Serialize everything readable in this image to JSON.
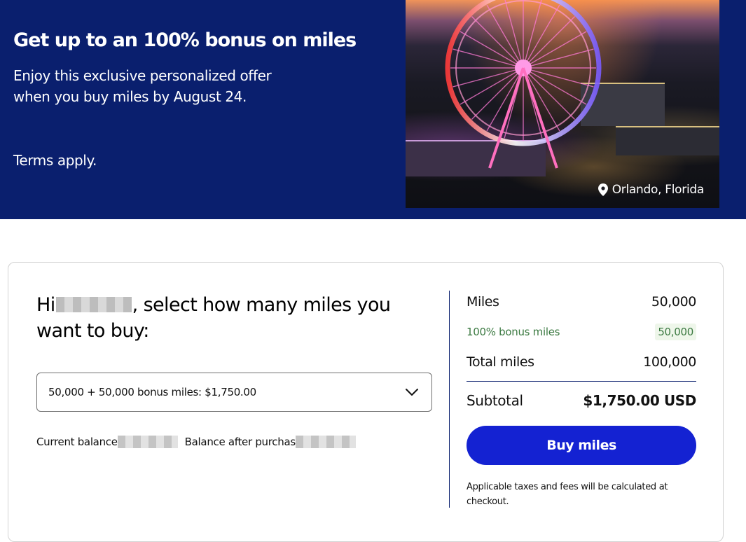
{
  "hero": {
    "title": "Get up to an 100% bonus on miles",
    "text": "Enjoy this exclusive personalized offer when you buy miles by August 24.",
    "terms": "Terms apply.",
    "photo_location": "Orlando, Florida",
    "location_icon": "map-pin-icon"
  },
  "purchase": {
    "greeting_start": "Hi",
    "greeting_end": ", select how many miles you want to buy:",
    "selected_option": "50,000 + 50,000 bonus miles: $1,750.00",
    "dropdown_icon": "chevron-down-icon",
    "current_balance_label": "Current balance",
    "balance_after_label": "Balance after purchas"
  },
  "summary": {
    "miles_label": "Miles",
    "miles_value": "50,000",
    "bonus_label": "100% bonus miles",
    "bonus_value": "50,000",
    "total_label": "Total miles",
    "total_value": "100,000",
    "subtotal_label": "Subtotal",
    "subtotal_value": "$1,750.00 USD",
    "buy_button": "Buy miles",
    "fine_print": "Applicable taxes and fees will be calculated at checkout."
  },
  "colors": {
    "hero_bg": "#0a1f6e",
    "button_bg": "#1422d2",
    "bonus_text": "#3c7a42"
  }
}
